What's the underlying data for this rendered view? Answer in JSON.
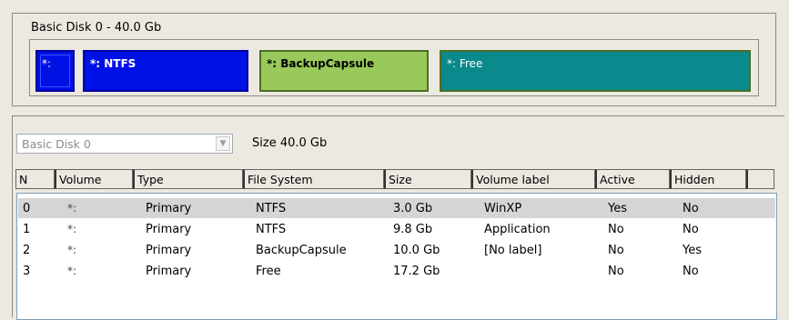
{
  "disk_map": {
    "title": "Basic Disk 0 - 40.0 Gb",
    "segments": [
      {
        "label": "*:"
      },
      {
        "label": "*: NTFS"
      },
      {
        "label": "*: BackupCapsule"
      },
      {
        "label": "*: Free"
      }
    ]
  },
  "toolbar": {
    "disk_select_value": "Basic Disk 0",
    "size_text": "Size 40.0 Gb"
  },
  "table": {
    "headers": [
      "N",
      "Volume",
      "Type",
      "File System",
      "Size",
      "Volume label",
      "Active",
      "Hidden",
      ""
    ],
    "rows": [
      {
        "n": "0",
        "volume": "*:",
        "type": "Primary",
        "fs": "NTFS",
        "size": "3.0 Gb",
        "label": "WinXP",
        "active": "Yes",
        "hidden": "No",
        "selected": true
      },
      {
        "n": "1",
        "volume": "*:",
        "type": "Primary",
        "fs": "NTFS",
        "size": "9.8 Gb",
        "label": "Application",
        "active": "No",
        "hidden": "No",
        "selected": false
      },
      {
        "n": "2",
        "volume": "*:",
        "type": "Primary",
        "fs": "BackupCapsule",
        "size": "10.0 Gb",
        "label": "[No label]",
        "active": "No",
        "hidden": "Yes",
        "selected": false
      },
      {
        "n": "3",
        "volume": "*:",
        "type": "Primary",
        "fs": "Free",
        "size": "17.2 Gb",
        "label": "",
        "active": "No",
        "hidden": "No",
        "selected": false
      }
    ]
  },
  "colors": {
    "primary_partition": "#0011e6",
    "backup_partition": "#99c95a",
    "free_space": "#0a8a8c",
    "selected_row": "#d5d5d5"
  }
}
